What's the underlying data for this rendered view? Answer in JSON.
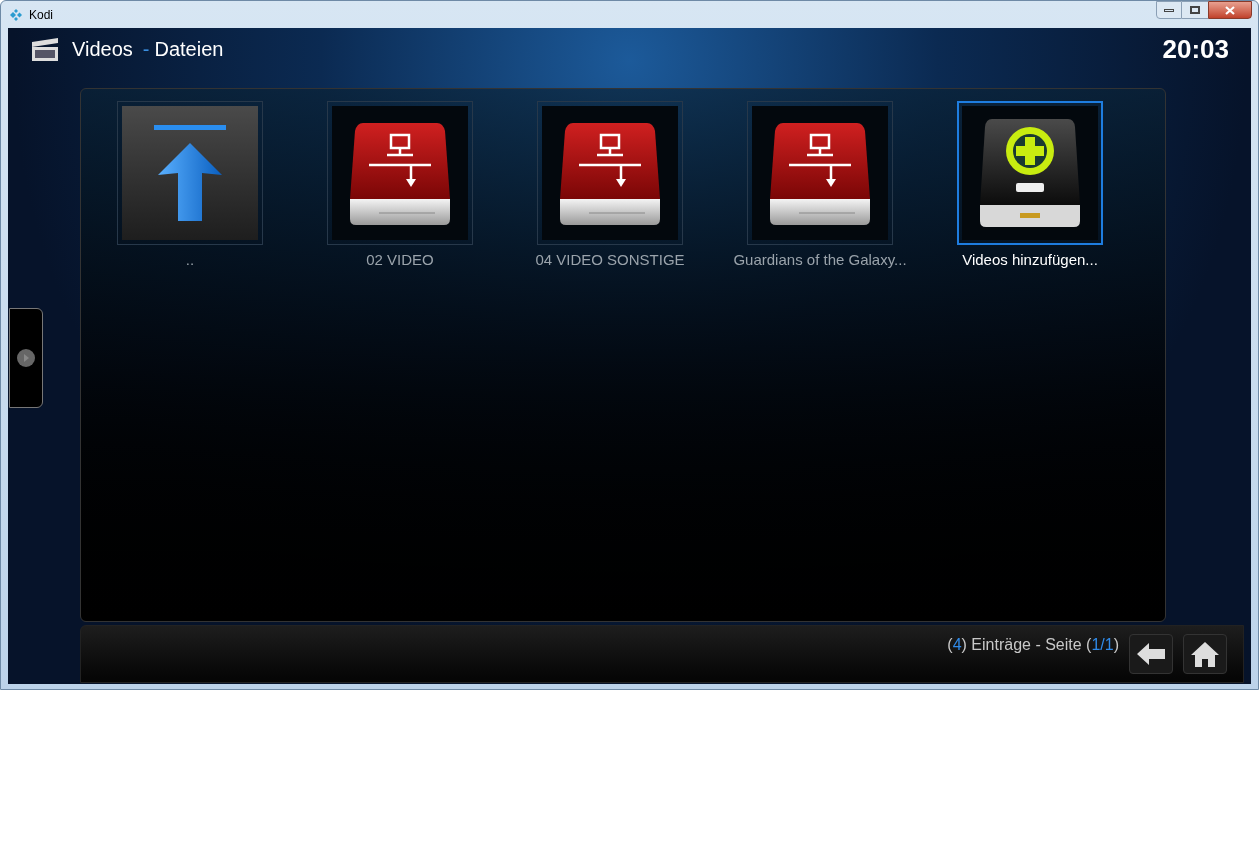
{
  "window": {
    "title": "Kodi"
  },
  "header": {
    "section": "Videos",
    "separator": "-",
    "subsection": "Dateien",
    "clock": "20:03"
  },
  "items": [
    {
      "kind": "up",
      "label": "..",
      "selected": false
    },
    {
      "kind": "drive",
      "label": "02 VIDEO",
      "selected": false
    },
    {
      "kind": "drive",
      "label": "04 VIDEO SONSTIGE",
      "selected": false
    },
    {
      "kind": "drive",
      "label": "Guardians of the Galaxy...",
      "selected": false
    },
    {
      "kind": "add",
      "label": "Videos hinzufügen...",
      "selected": true
    }
  ],
  "status": [
    {
      "text": "(",
      "highlight": false
    },
    {
      "text": "4",
      "highlight": true
    },
    {
      "text": ") Einträge - Seite (",
      "highlight": false
    },
    {
      "text": "1/1",
      "highlight": true
    },
    {
      "text": ")",
      "highlight": false
    }
  ]
}
